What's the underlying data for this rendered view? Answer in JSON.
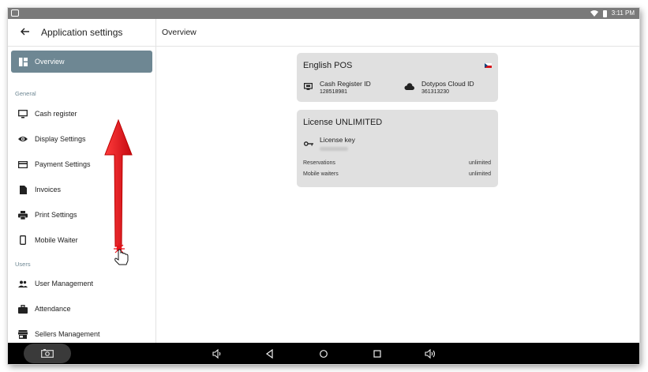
{
  "status_bar": {
    "time": "3:11 PM"
  },
  "sidebar": {
    "title": "Application settings",
    "active_item": "Overview",
    "sections": [
      {
        "label": "General"
      },
      {
        "label": "Users"
      }
    ],
    "items": [
      {
        "label": "Overview",
        "icon": "dashboard-icon"
      },
      {
        "label": "Cash register",
        "icon": "monitor-icon"
      },
      {
        "label": "Display Settings",
        "icon": "eye-icon"
      },
      {
        "label": "Payment Settings",
        "icon": "credit-card-icon"
      },
      {
        "label": "Invoices",
        "icon": "document-icon"
      },
      {
        "label": "Print Settings",
        "icon": "printer-icon"
      },
      {
        "label": "Mobile Waiter",
        "icon": "phone-icon"
      },
      {
        "label": "User Management",
        "icon": "people-icon"
      },
      {
        "label": "Attendance",
        "icon": "briefcase-icon"
      },
      {
        "label": "Sellers Management",
        "icon": "store-icon"
      }
    ]
  },
  "main": {
    "title": "Overview",
    "pos_card": {
      "name": "English POS",
      "cash_register_label": "Cash Register ID",
      "cash_register_id": "128518981",
      "cloud_label": "Dotypos Cloud ID",
      "cloud_id": "361313230"
    },
    "license_card": {
      "title": "License UNLIMITED",
      "key_label": "License key",
      "rows": [
        {
          "label": "Reservations",
          "value": "unlimited"
        },
        {
          "label": "Mobile waiters",
          "value": "unlimited"
        }
      ]
    }
  },
  "colors": {
    "active_nav": "#6e8793",
    "card_bg": "#e0e0e0",
    "annotation_arrow": "#e8131b"
  }
}
